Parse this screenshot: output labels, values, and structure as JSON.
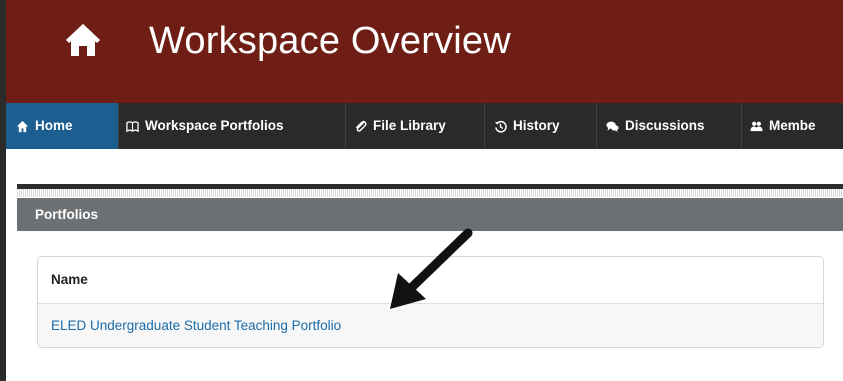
{
  "header": {
    "title": "Workspace Overview",
    "icon": "home-icon",
    "background_color": "#6e1e14"
  },
  "nav": {
    "items": [
      {
        "label": "Home",
        "icon": "home-icon",
        "active": true
      },
      {
        "label": "Workspace Portfolios",
        "icon": "book-icon",
        "active": false
      },
      {
        "label": "File Library",
        "icon": "paperclip-icon",
        "active": false
      },
      {
        "label": "History",
        "icon": "history-icon",
        "active": false
      },
      {
        "label": "Discussions",
        "icon": "chat-bubbles-icon",
        "active": false
      },
      {
        "label": "Membe",
        "icon": "users-icon",
        "active": false
      }
    ],
    "active_color": "#1b5e8f"
  },
  "section": {
    "title": "Portfolios"
  },
  "table": {
    "header": "Name",
    "rows": [
      {
        "name": "ELED Undergraduate Student Teaching Portfolio"
      }
    ]
  },
  "annotation": {
    "icon": "arrow-pointer-icon"
  }
}
